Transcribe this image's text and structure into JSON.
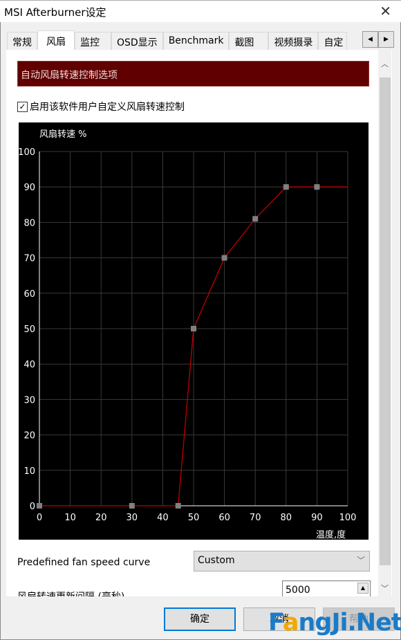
{
  "window": {
    "title": "MSI Afterburner设定"
  },
  "tabs": [
    "常规",
    "风扇",
    "监控",
    "OSD显示",
    "Benchmark",
    "截图",
    "视频摄录",
    "自定"
  ],
  "active_tab": "风扇",
  "section_header": "自动风扇转速控制选项",
  "enable_checkbox": {
    "label": "启用该软件用户自定义风扇转速控制",
    "checked": true
  },
  "chart_data": {
    "type": "line",
    "ylabel": "风扇转速 %",
    "xlabel": "温度,度",
    "xlim": [
      0,
      100
    ],
    "ylim": [
      0,
      100
    ],
    "xticks": [
      "0",
      "10",
      "20",
      "30",
      "40",
      "50",
      "60",
      "70",
      "80",
      "90",
      "100"
    ],
    "yticks": [
      "0",
      "10",
      "20",
      "30",
      "40",
      "50",
      "60",
      "70",
      "80",
      "90",
      "100"
    ],
    "grid": true,
    "points": [
      [
        0,
        0
      ],
      [
        30,
        0
      ],
      [
        45,
        0
      ],
      [
        50,
        50
      ],
      [
        60,
        70
      ],
      [
        70,
        81
      ],
      [
        80,
        90
      ],
      [
        90,
        90
      ]
    ],
    "extends_to": 100,
    "line_color": "#c00000",
    "point_color": "#808080",
    "background": "#000000",
    "grid_color": "#3a3a3a"
  },
  "predefined": {
    "label": "Predefined fan speed curve",
    "value": "Custom"
  },
  "interval": {
    "label": "风扇转速更新间隔 (毫秒)",
    "value": "5000"
  },
  "buttons": {
    "ok": "确定",
    "cancel": "取消",
    "help": "帮助"
  },
  "watermark": "FangJi.Net"
}
